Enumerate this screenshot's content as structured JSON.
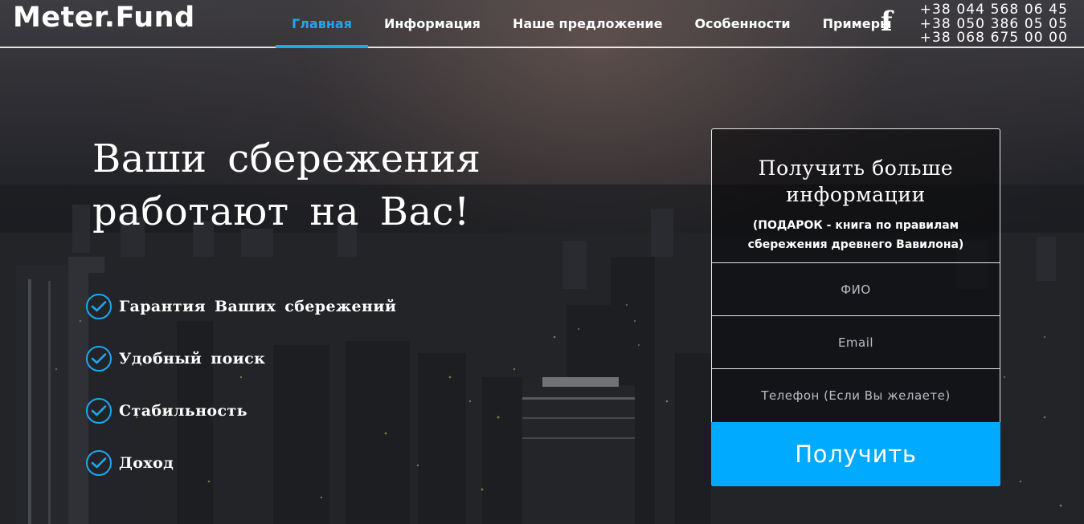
{
  "header": {
    "logo": "Meter.Fund",
    "nav": [
      {
        "label": "Главная",
        "active": true
      },
      {
        "label": "Информация",
        "active": false
      },
      {
        "label": "Наше предложение",
        "active": false
      },
      {
        "label": "Особенности",
        "active": false
      },
      {
        "label": "Примеры",
        "active": false
      }
    ],
    "social_icon": "facebook-icon",
    "social_glyph": "f",
    "phones": [
      "+38 044 568 06 45",
      "+38 050 386 05 05",
      "+38 068 675 00 00"
    ]
  },
  "hero": {
    "title_line1": "Ваши сбережения",
    "title_line2": "работают на Вас!",
    "features": [
      {
        "icon": "check-circle-icon",
        "label": "Гарантия Ваших сбережений"
      },
      {
        "icon": "check-circle-icon",
        "label": "Удобный поиск"
      },
      {
        "icon": "check-circle-icon",
        "label": "Стабильность"
      },
      {
        "icon": "check-circle-icon",
        "label": "Доход"
      }
    ]
  },
  "form": {
    "title_line1": "Получить больше",
    "title_line2": "информации",
    "subtitle_line1": "(ПОДАРОК - книга по правилам",
    "subtitle_line2": "сбережения древнего Вавилона)",
    "fields": {
      "name_placeholder": "ФИО",
      "email_placeholder": "Email",
      "phone_placeholder": "Телефон (Если Вы желаете)"
    },
    "submit_label": "Получить"
  },
  "colors": {
    "accent": "#00aaff",
    "nav_active": "#1ea7ee",
    "text": "#ffffff"
  }
}
